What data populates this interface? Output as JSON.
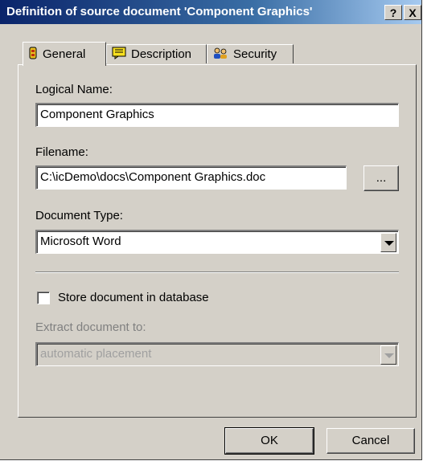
{
  "window": {
    "title": "Definition of source document 'Component Graphics'",
    "help_label": "?",
    "close_label": "X"
  },
  "tabs": [
    {
      "label": "General",
      "icon": "general-icon",
      "active": true
    },
    {
      "label": "Description",
      "icon": "description-icon",
      "active": false
    },
    {
      "label": "Security",
      "icon": "security-icon",
      "active": false
    }
  ],
  "form": {
    "logical_name_label": "Logical Name:",
    "logical_name_value": "Component Graphics",
    "filename_label": "Filename:",
    "filename_value": "C:\\icDemo\\docs\\Component Graphics.doc",
    "browse_label": "...",
    "document_type_label": "Document Type:",
    "document_type_value": "Microsoft Word",
    "store_label": "Store document in database",
    "store_checked": false,
    "extract_label": "Extract document to:",
    "extract_value": "automatic placement"
  },
  "buttons": {
    "ok": "OK",
    "cancel": "Cancel"
  }
}
